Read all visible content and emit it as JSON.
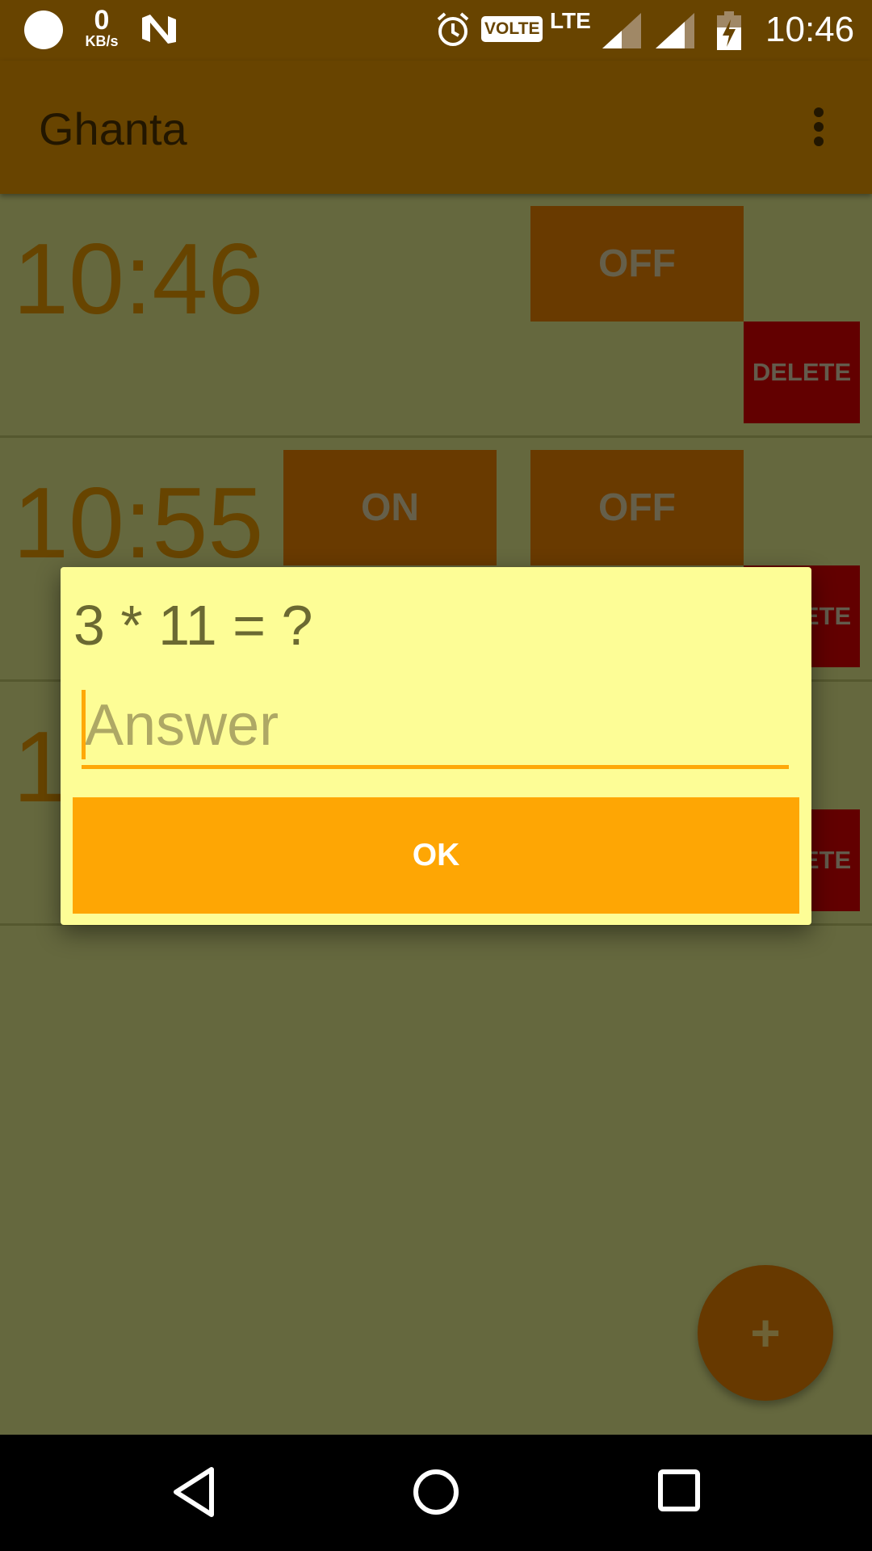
{
  "status_bar": {
    "speed_value": "0",
    "speed_unit": "KB/s",
    "volte": "VOLTE",
    "network": "LTE",
    "time": "10:46",
    "icons": [
      "circle-icon",
      "n-logo-icon",
      "alarm-clock-icon",
      "signal-icon",
      "signal-icon",
      "battery-charging-icon"
    ]
  },
  "app_bar": {
    "title": "Ghanta",
    "menu_icon": "more-vert-icon"
  },
  "alarms": [
    {
      "time": "10:46",
      "on_label": "",
      "off_label": "OFF",
      "delete_label": "DELETE"
    },
    {
      "time": "10:55",
      "on_label": "ON",
      "off_label": "OFF",
      "delete_label": "DELETE"
    },
    {
      "time": "1",
      "on_label": "",
      "off_label": "",
      "delete_label": "DELETE"
    }
  ],
  "dialog": {
    "question": "3 * 11 = ?",
    "answer_placeholder": "Answer",
    "answer_value": "",
    "ok_label": "OK"
  },
  "fab": {
    "label": "+"
  },
  "nav_bar": {
    "icons": [
      "back-icon",
      "home-icon",
      "recents-icon"
    ]
  },
  "colors": {
    "app_bar": "#684400",
    "content_bg": "#65683e",
    "dialog_bg": "#fdfd96",
    "accent": "#fea604",
    "delete": "#620000"
  }
}
